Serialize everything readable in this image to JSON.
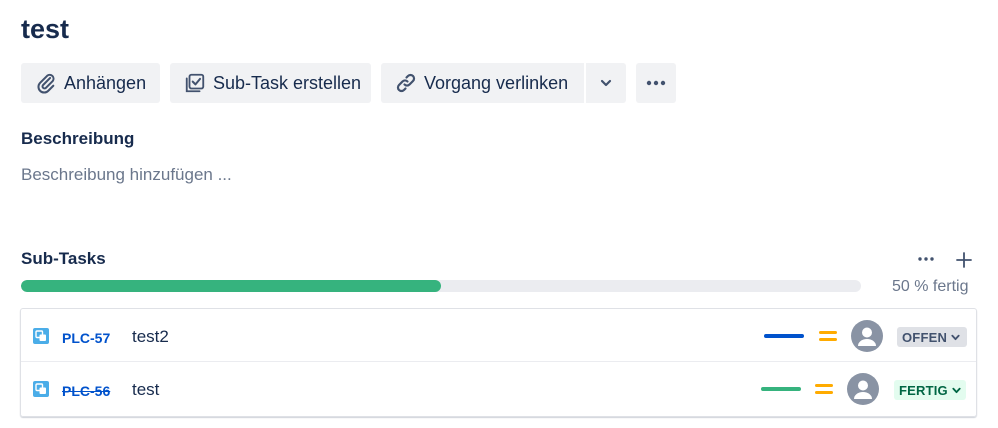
{
  "issue": {
    "title": "test"
  },
  "toolbar": {
    "attach_label": "Anhängen",
    "subtask_label": "Sub-Task erstellen",
    "link_label": "Vorgang verlinken"
  },
  "description": {
    "heading": "Beschreibung",
    "placeholder": "Beschreibung hinzufügen ..."
  },
  "subtasks": {
    "heading": "Sub-Tasks",
    "progress_percent": 50,
    "progress_text": "50 % fertig",
    "items": [
      {
        "key": "PLC-57",
        "summary": "test2",
        "status": "OFFEN",
        "done": false,
        "bar_color": "#0052cc",
        "status_bg": "#dfe1e6",
        "status_color": "#42526e",
        "priority_color": "#ffab00"
      },
      {
        "key": "PLC-56",
        "summary": "test",
        "status": "FERTIG",
        "done": true,
        "bar_color": "#36b37e",
        "status_bg": "#e3fcef",
        "status_color": "#006644",
        "priority_color": "#ffab00"
      }
    ]
  },
  "colors": {
    "progress_fill": "#36b37e",
    "subtask_icon": "#4bade8"
  }
}
